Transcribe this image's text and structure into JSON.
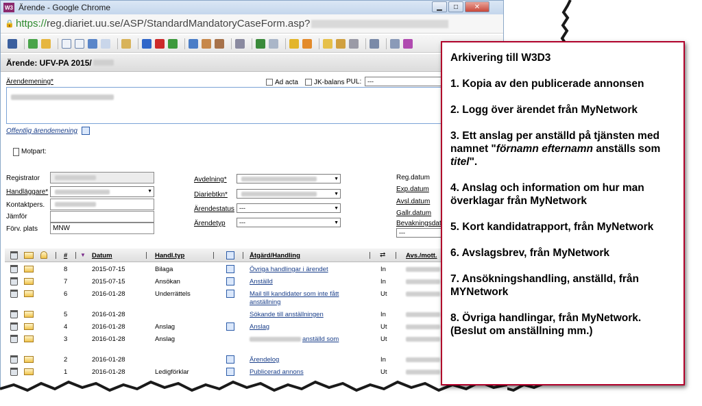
{
  "window": {
    "title": "Ärende - Google Chrome",
    "app_icon": "W3",
    "buttons": [
      "▁",
      "□",
      "✕"
    ]
  },
  "address": {
    "https": "https://",
    "rest": "reg.diariet.uu.se/ASP/StandardMandatoryCaseForm.asp?"
  },
  "case": {
    "label": "Ärende: UFV-PA 2015/"
  },
  "form": {
    "arendemening_label": "Ärendemening*",
    "ad_acta_label": "Ad acta",
    "jk_balans_label": "JK-balans",
    "pul_label": "PUL:",
    "pul_value": "---",
    "offentlig_label": "Offentlig ärendemening",
    "motpart_label": "Motpart:",
    "registrator_label": "Registrator",
    "handlaggare_label": "Handläggare*",
    "kontaktpers_label": "Kontaktpers.",
    "jamfor_label": "Jämför",
    "forv_plats_label": "Förv. plats",
    "forv_plats_value": "MNW",
    "avdelning_label": "Avdelning*",
    "diariebtkn_label": "Diariebtkn*",
    "arendestatus_label": "Ärendestatus",
    "arendestatus_value": "---",
    "arendetyp_label": "Ärendetyp",
    "arendetyp_value": "---",
    "reg_datum_label": "Reg.datum",
    "exp_datum_label": "Exp.datum",
    "avsl_datum_label": "Avsl.datum",
    "gallr_datum_label": "Gallr.datum",
    "bevakning_label": "Bevakningsdatum",
    "bevakning_value": "---"
  },
  "grid": {
    "headers": {
      "num": "#",
      "datum": "Datum",
      "handltyp": "Handl.typ",
      "atgard": "Åtgärd/Handling",
      "avsmott": "Avs./mott."
    },
    "rows": [
      {
        "num": "8",
        "date": "2015-07-15",
        "type": "Bilaga",
        "action": "Övriga handlingar i ärendet",
        "action2": "",
        "dir": "In"
      },
      {
        "num": "7",
        "date": "2015-07-15",
        "type": "Ansökan",
        "action": "Anställd",
        "action2": "",
        "dir": "In"
      },
      {
        "num": "6",
        "date": "2016-01-28",
        "type": "Underrättels",
        "action": "Mail till kandidater som inte fått",
        "action2": "anställning",
        "dir": "Ut"
      },
      {
        "num": "5",
        "date": "2016-01-28",
        "type": "",
        "action": "Sökande till anställningen",
        "action2": "",
        "dir": "In"
      },
      {
        "num": "4",
        "date": "2016-01-28",
        "type": "Anslag",
        "action": "Anslag",
        "action2": "",
        "dir": "Ut"
      },
      {
        "num": "3",
        "date": "2016-01-28",
        "type": "Anslag",
        "action": "anställd som",
        "action2": "",
        "dir": "Ut"
      },
      {
        "num": "2",
        "date": "2016-01-28",
        "type": "",
        "action": "Ärendelog",
        "action2": "",
        "dir": "In"
      },
      {
        "num": "1",
        "date": "2016-01-28",
        "type": "Ledigförklar",
        "action": "Publicerad annons",
        "action2": "",
        "dir": "Ut"
      }
    ]
  },
  "panel": {
    "title": "Arkivering till W3D3",
    "item1": "1. Kopia av den publicerade annonsen",
    "item2": "2. Logg över ärendet från MyNetwork",
    "item3a": "3. Ett anslag per anställd på tjänsten med namnet \"",
    "item3b": "förnamn efternamn",
    "item3c": " anställs som ",
    "item3d": "titel",
    "item3e": "\".",
    "item4": "4. Anslag och information om hur man överklagar från MyNetwork",
    "item5": "5. Kort kandidatrapport, från MyNetwork",
    "item6": "6. Avslagsbrev, från MyNetwork",
    "item7": "7. Ansökningshandling, anställd, från MYNetwork",
    "item8": "8. Övriga handlingar, från MyNetwork. (Beslut om anställning mm.)"
  },
  "colors": {
    "panel_border": "#b0002a",
    "link": "#1a3f8a",
    "https_green": "#2d8a2d"
  }
}
